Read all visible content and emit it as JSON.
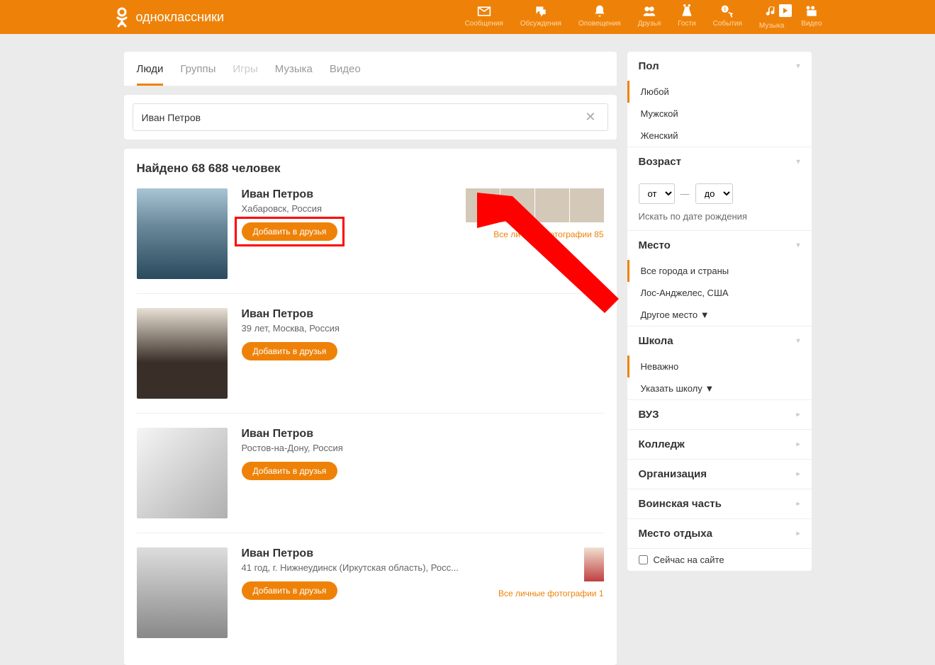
{
  "header": {
    "brand": "одноклассники",
    "nav": [
      {
        "label": "Сообщения",
        "icon": "mail"
      },
      {
        "label": "Обсуждения",
        "icon": "chat"
      },
      {
        "label": "Оповещения",
        "icon": "bell"
      },
      {
        "label": "Друзья",
        "icon": "friends"
      },
      {
        "label": "Гости",
        "icon": "guests"
      },
      {
        "label": "События",
        "icon": "events"
      },
      {
        "label": "Музыка",
        "icon": "music"
      },
      {
        "label": "Видео",
        "icon": "video"
      }
    ]
  },
  "tabs": [
    {
      "label": "Люди",
      "active": true
    },
    {
      "label": "Группы"
    },
    {
      "label": "Игры",
      "disabled": true
    },
    {
      "label": "Музыка"
    },
    {
      "label": "Видео"
    }
  ],
  "search": {
    "value": "Иван Петров"
  },
  "results": {
    "title": "Найдено 68 688 человек",
    "add_label": "Добавить в друзья",
    "items": [
      {
        "name": "Иван Петров",
        "meta": "Хабаровск, Россия",
        "thumbs": 4,
        "all_photos": "Все личные фотографии 85",
        "highlighted": true
      },
      {
        "name": "Иван Петров",
        "meta": "39 лет, Москва, Россия"
      },
      {
        "name": "Иван Петров",
        "meta": "Ростов-на-Дону, Россия"
      },
      {
        "name": "Иван Петров",
        "meta": "41 год, г. Нижнеудинск (Иркутская область), Росс...",
        "side_thumb": true,
        "all_photos": "Все личные фотографии 1"
      }
    ]
  },
  "filters": {
    "gender": {
      "title": "Пол",
      "options": [
        "Любой",
        "Мужской",
        "Женский"
      ],
      "selected": "Любой"
    },
    "age": {
      "title": "Возраст",
      "from": "от",
      "to": "до",
      "birthday_link": "Искать по дате рождения"
    },
    "place": {
      "title": "Место",
      "options": [
        "Все города и страны",
        "Лос-Анджелес, США",
        "Другое место ▼"
      ],
      "selected": "Все города и страны"
    },
    "school": {
      "title": "Школа",
      "options": [
        "Неважно",
        "Указать школу ▼"
      ],
      "selected": "Неважно"
    },
    "collapsed": [
      {
        "title": "ВУЗ"
      },
      {
        "title": "Колледж"
      },
      {
        "title": "Организация"
      },
      {
        "title": "Воинская часть"
      },
      {
        "title": "Место отдыха"
      }
    ],
    "online_now": "Сейчас на сайте"
  }
}
